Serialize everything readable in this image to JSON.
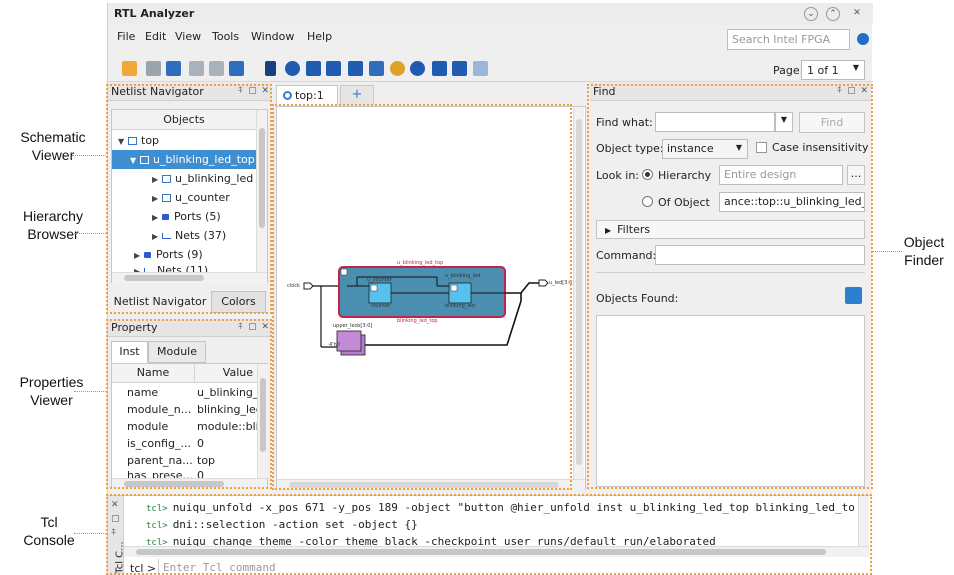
{
  "callouts": {
    "schematic_viewer": [
      "Schematic",
      "Viewer"
    ],
    "hierarchy_browser": [
      "Hierarchy",
      "Browser"
    ],
    "properties_viewer": [
      "Properties",
      "Viewer"
    ],
    "tcl_console": [
      "Tcl",
      "Console"
    ],
    "object_finder": [
      "Object",
      "Finder"
    ]
  },
  "window": {
    "title": "RTL Analyzer"
  },
  "menu": [
    "File",
    "Edit",
    "View",
    "Tools",
    "Window",
    "Help"
  ],
  "search": {
    "placeholder": "Search Intel FPGA"
  },
  "toolbar": {
    "page_label": "Page:",
    "page_value": "1 of 1"
  },
  "netlist_navigator": {
    "title": "Netlist Navigator",
    "column_header": "Objects",
    "tree": [
      {
        "label": "top",
        "icon": "module-icon",
        "expanded": true
      },
      {
        "label": "u_blinking_led_top",
        "icon": "module-icon",
        "selected": true
      },
      {
        "label": "u_blinking_led",
        "icon": "module-icon"
      },
      {
        "label": "u_counter",
        "icon": "module-icon"
      },
      {
        "label": "Ports (5)",
        "icon": "port-icon"
      },
      {
        "label": "Nets (37)",
        "icon": "net-icon"
      },
      {
        "label": "Ports (9)",
        "icon": "port-icon"
      },
      {
        "label": "Nets (11)",
        "icon": "net-icon"
      }
    ],
    "tabs": [
      "Netlist Navigator",
      "Colors"
    ]
  },
  "property": {
    "title": "Property",
    "tabs": [
      "Inst",
      "Module"
    ],
    "columns": [
      "Name",
      "Value"
    ],
    "rows": [
      {
        "name": "name",
        "value": "u_blinking_"
      },
      {
        "name": "module_n...",
        "value": "blinking_lec"
      },
      {
        "name": "module",
        "value": "module::bli"
      },
      {
        "name": "is_config_...",
        "value": "0"
      },
      {
        "name": "parent_na...",
        "value": "top"
      },
      {
        "name": "has_prese...",
        "value": "0"
      }
    ]
  },
  "schematic": {
    "tab_label": "top:1",
    "add_tab": "+",
    "top_module_label": "u_blinking_led_top",
    "top_module_bottom_label": "blinking_led_top",
    "inner_left_label": "u_counter",
    "inner_left_bottom": "counter",
    "inner_right_label": "u_blinking_led",
    "inner_right_bottom": "blinking_led",
    "input_port": "clock",
    "output_port": "u_led[3:0]",
    "reg_label": "upper_leds[3:0]",
    "reg_value": "4'h0"
  },
  "find": {
    "title": "Find",
    "find_what_label": "Find what:",
    "find_button": "Find",
    "object_type_label": "Object type:",
    "object_type_value": "instance",
    "case_label": "Case insensitivity",
    "look_in_label": "Look in:",
    "hierarchy_option": "Hierarchy",
    "hierarchy_placeholder": "Entire design",
    "browse_button": "...",
    "of_object_option": "Of Object",
    "of_object_value": "ance::top::u_blinking_led_top",
    "filters_label": "Filters",
    "command_label": "Command:",
    "objects_found_label": "Objects Found:"
  },
  "tcl": {
    "side_label": "Tcl C...",
    "prefix": "tcl>",
    "lines": [
      "nuiqu_unfold -x_pos 671 -y_pos 189 -object \"button @hier_unfold inst u_blinking_led_top blinking_led_to",
      "dni::selection -action set -object {}",
      "nuiqu change theme -color theme black -checkpoint user runs/default run/elaborated"
    ],
    "prompt": "tcl >",
    "input_placeholder": "Enter Tcl command"
  },
  "colors": {
    "selection": "#3d8fd1",
    "module_fill": "#4b8fb0",
    "module_border": "#c5244a",
    "register_fill": "#c58ad6",
    "outline": "#f0a040"
  }
}
